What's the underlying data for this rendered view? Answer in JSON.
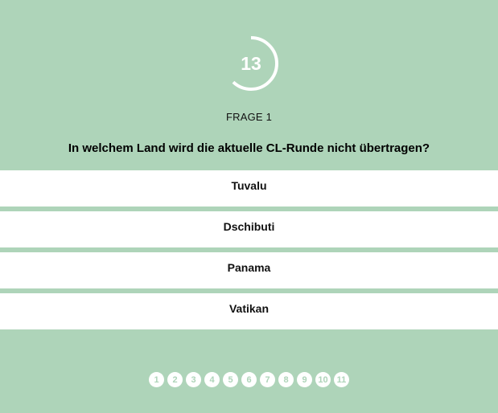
{
  "timer": {
    "seconds": "13",
    "progress_fraction": 0.62,
    "color": "#ffffff"
  },
  "question": {
    "label": "FRAGE 1",
    "text": "In welchem Land wird die aktuelle CL-Runde nicht übertragen?"
  },
  "answers": [
    {
      "label": "Tuvalu"
    },
    {
      "label": "Dschibuti"
    },
    {
      "label": "Panama"
    },
    {
      "label": "Vatikan"
    }
  ],
  "pager": {
    "pages": [
      "1",
      "2",
      "3",
      "4",
      "5",
      "6",
      "7",
      "8",
      "9",
      "10",
      "11"
    ]
  },
  "colors": {
    "background": "#aed4b9",
    "answer_background": "#ffffff"
  }
}
